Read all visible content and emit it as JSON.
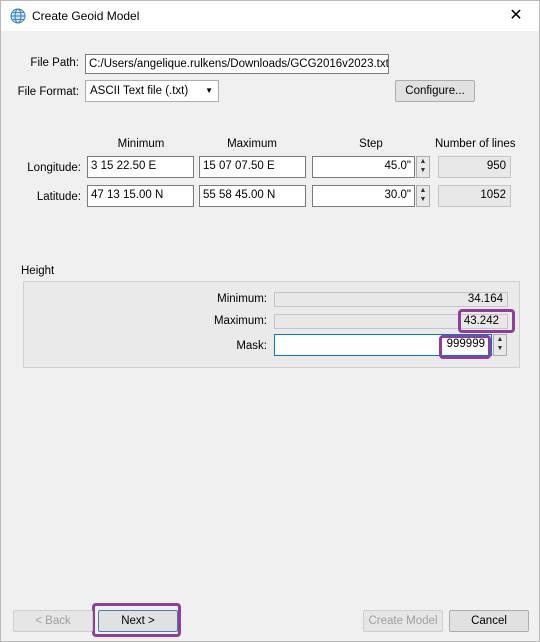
{
  "window": {
    "title": "Create Geoid Model",
    "close_glyph": "✕",
    "icon": "globe-icon"
  },
  "file": {
    "path_label": "File Path:",
    "path_value": "C:/Users/angelique.rulkens/Downloads/GCG2016v2023.txt",
    "format_label": "File Format:",
    "format_value": "ASCII Text file (.txt)",
    "configure_label": "Configure..."
  },
  "grid": {
    "headers": {
      "minimum": "Minimum",
      "maximum": "Maximum",
      "step": "Step",
      "lines": "Number of lines"
    },
    "longitude": {
      "label": "Longitude:",
      "min": "3 15 22.50 E",
      "max": "15 07 07.50 E",
      "step": "45.0\"",
      "lines": "950"
    },
    "latitude": {
      "label": "Latitude:",
      "min": "47 13 15.00 N",
      "max": "55 58 45.00 N",
      "step": "30.0\"",
      "lines": "1052"
    }
  },
  "height": {
    "section_label": "Height",
    "minimum_label": "Minimum:",
    "minimum_value": "34.164",
    "maximum_label": "Maximum:",
    "maximum_value": "43.242",
    "mask_label": "Mask:",
    "mask_value": "999999"
  },
  "footer": {
    "back_label": "< Back",
    "next_label": "Next >",
    "create_label": "Create Model",
    "cancel_label": "Cancel"
  },
  "colors": {
    "highlight": "#8e3f9e",
    "accent": "#0078d7"
  }
}
